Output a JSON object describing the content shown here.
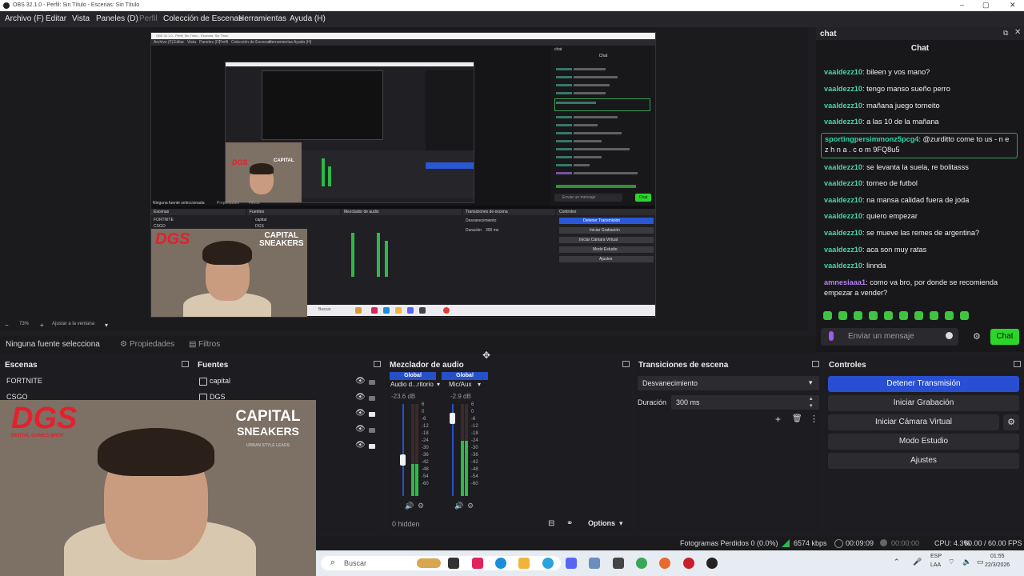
{
  "window": {
    "title": "OBS 32.1.0 - Perfil: Sin Título - Escenas: Sin Título"
  },
  "menu": [
    "Archivo (F)",
    "Editar",
    "Vista",
    "Paneles (D)",
    "Perfil",
    "Colección de Escenas",
    "Herramientas",
    "Ayuda (H)"
  ],
  "preview": {
    "zoom": "73%",
    "fit_label": "Ajustar a la ventana",
    "inner_title": "OBS 32.1.0 - Perfil: Sin Título - Escenas: Sin Título",
    "inner_menu": [
      "Archivo (F)",
      "Editar",
      "Vista",
      "Paneles (D)",
      "Perfil",
      "Colección de Escenas",
      "Herramientas",
      "Ayuda (H)"
    ],
    "inner_chat_title": "Chat",
    "inner_chat_label": "chat",
    "inner_input_placeholder": "Enviar un mensaje",
    "inner_chat_button": "Chat",
    "inner_docks": [
      "Escenas",
      "Fuentes",
      "Mezclador de audio",
      "Transiciones de escena",
      "Controles"
    ],
    "inner_scenes": [
      "FORTNITE",
      "CSGO"
    ],
    "inner_sources": [
      "capital",
      "DGS"
    ],
    "inner_transition": "Desvanecimiento",
    "inner_duration_label": "Duración",
    "inner_duration": "300 ms",
    "inner_controls": [
      "Detener Transmisión",
      "Iniciar Grabación",
      "Iniciar Cámara Virtual",
      "Modo Estudio",
      "Ajustes"
    ],
    "inner_no_source": "Ninguna fuente seleccionada",
    "inner_props": "Propiedades",
    "inner_filters": "Filtros",
    "inner_search": "Buscar"
  },
  "overlay": {
    "dgs_logo": "DGS",
    "dgs_sub": "DIGITAL GAMES SHOP",
    "capital_logo": "CAPITAL",
    "capital_logo2": "SNEAKERS",
    "capital_sub": "URBAN STYLE LEADS"
  },
  "chat": {
    "dock_title": "chat",
    "header": "Chat",
    "messages": [
      {
        "user": "vaaldezz10",
        "text": "bileen y vos mano?"
      },
      {
        "user": "vaaldezz10",
        "text": "tengo manso sueño perro"
      },
      {
        "user": "vaaldezz10",
        "text": "mañana juego torneito"
      },
      {
        "user": "vaaldezz10",
        "text": "a las 10 de la mañana"
      },
      {
        "user": "sportingpersimmonz5pcg4",
        "text": "@zurditto come to us - n e z h n a . c o m 9FQ8u5"
      },
      {
        "user": "vaaldezz10",
        "text": "se levanta la suela, re bolitasss"
      },
      {
        "user": "vaaldezz10",
        "text": "torneo de futbol"
      },
      {
        "user": "vaaldezz10",
        "text": "na mansa calidad fuera de joda"
      },
      {
        "user": "vaaldezz10",
        "text": "quiero empezar"
      },
      {
        "user": "vaaldezz10",
        "text": "se mueve las remes de argentina?"
      },
      {
        "user": "vaaldezz10",
        "text": "aca son muy ratas"
      },
      {
        "user": "vaaldezz10",
        "text": "linnda"
      },
      {
        "user": "amnesiaaa1",
        "text": "como va bro, por donde se recomienda empezar a vender?"
      }
    ],
    "input_placeholder": "Enviar un mensaje",
    "send_label": "Chat",
    "colors": {
      "user": "#4fd1a8",
      "user_highlight": "#2fd6a8",
      "user_purple": "#b57cf5",
      "accent": "#2bd62b"
    }
  },
  "sources_toolbar": {
    "no_source": "Ninguna fuente selecciona",
    "properties": "Propiedades",
    "filters": "Filtros"
  },
  "scenes": {
    "title": "Escenas",
    "items": [
      "FORTNITE",
      "CSGO"
    ]
  },
  "sources": {
    "title": "Fuentes",
    "items": [
      "capital",
      "DGS"
    ]
  },
  "mixer": {
    "title": "Mezclador de audio",
    "channels": [
      {
        "tag": "Global",
        "name": "Audio d...ritorio",
        "db": "-23.6 dB",
        "level": 0.45
      },
      {
        "tag": "Global",
        "name": "Mic/Aux",
        "db": "-2.9 dB",
        "level": 0.9
      }
    ],
    "scale": [
      "6",
      "0",
      "-6",
      "-12",
      "-18",
      "-24",
      "-30",
      "-36",
      "-42",
      "-48",
      "-54",
      "-60"
    ],
    "hidden": "0 hidden",
    "options": "Options"
  },
  "transitions": {
    "title": "Transiciones de escena",
    "selected": "Desvanecimiento",
    "duration_label": "Duración",
    "duration": "300 ms"
  },
  "controls": {
    "title": "Controles",
    "buttons": [
      "Detener Transmisión",
      "Iniciar Grabación",
      "Iniciar Cámara Virtual",
      "Modo Estudio",
      "Ajustes"
    ]
  },
  "status": {
    "dropped": "Fotogramas Perdidos 0 (0.0%)",
    "bitrate": "6574 kbps",
    "stream_time": "00:09:09",
    "rec_time": "00:00:00",
    "cpu": "CPU: 4.3%",
    "fps": "60.00 / 60.00 FPS"
  },
  "taskbar": {
    "search": "Buscar",
    "lang1": "ESP",
    "lang2": "LAA",
    "time": "01:55",
    "date": "22/3/2026"
  }
}
